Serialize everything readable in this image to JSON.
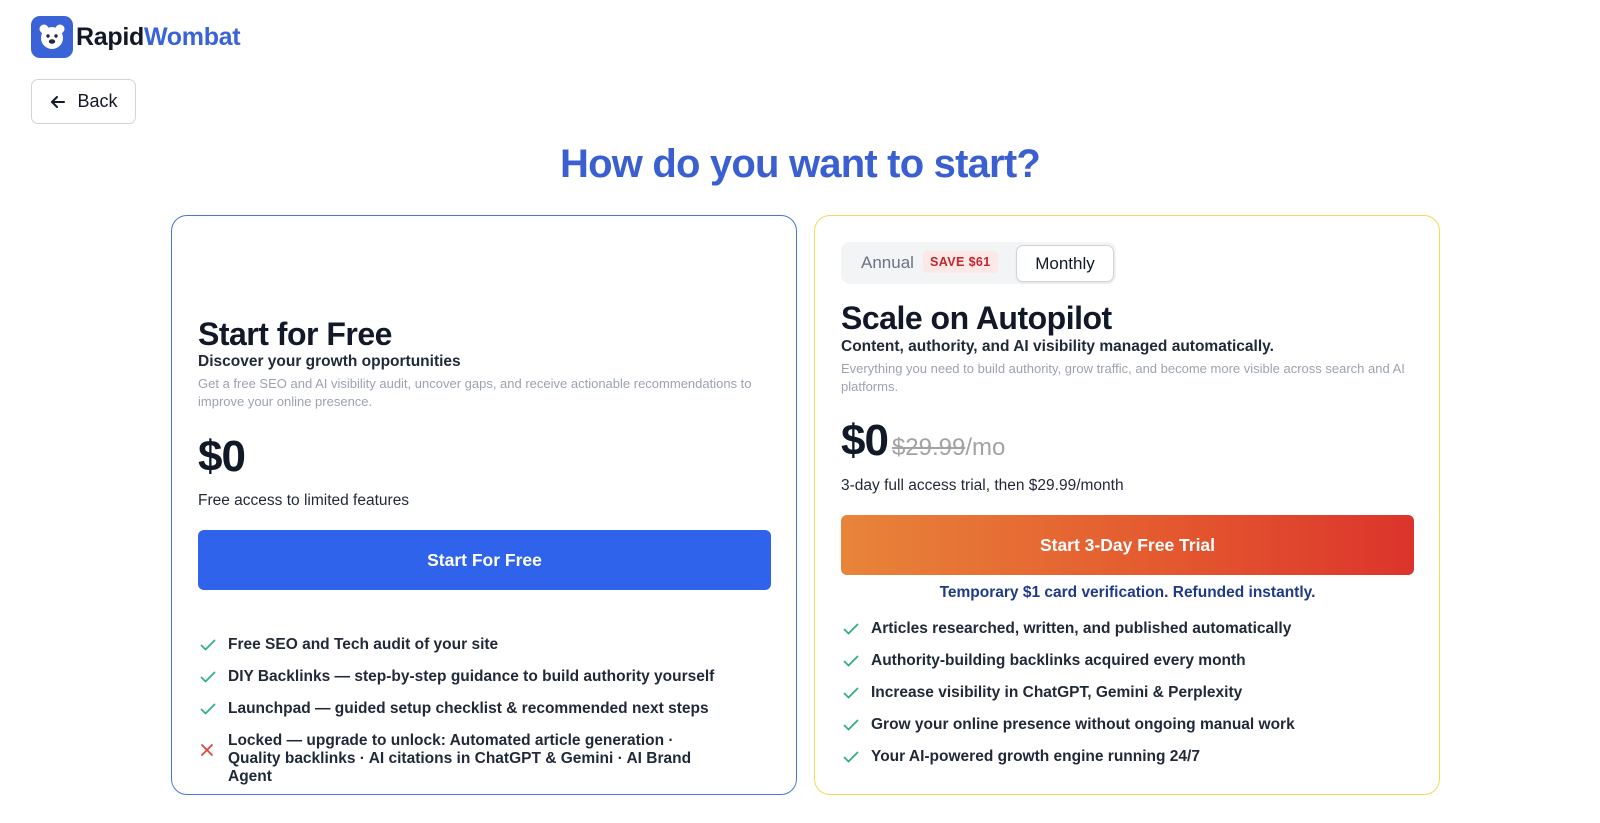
{
  "brand": {
    "name_part1": "Rapid",
    "name_part2": "Wombat",
    "accent_color": "#3a63d8"
  },
  "nav": {
    "back_label": "Back"
  },
  "heading": "How do you want to start?",
  "free_plan": {
    "title": "Start for Free",
    "subtitle": "Discover your growth opportunities",
    "description": "Get a free SEO and AI visibility audit, uncover gaps, and receive actionable recommendations to improve your online presence.",
    "price": "$0",
    "price_note": "Free access to limited features",
    "cta_label": "Start For Free",
    "features": [
      {
        "text": "Free SEO and Tech audit of your site",
        "icon": "check-icon"
      },
      {
        "text": "DIY Backlinks — step-by-step guidance to build authority yourself",
        "icon": "check-icon"
      },
      {
        "text": "Launchpad — guided setup checklist & recommended next steps",
        "icon": "check-icon"
      },
      {
        "text": "Locked — upgrade to unlock: Automated article generation · Quality backlinks · AI citations in ChatGPT & Gemini · AI Brand Agent",
        "icon": "x-icon"
      }
    ]
  },
  "pro_plan": {
    "billing_toggle": {
      "annual_label": "Annual",
      "save_badge": "SAVE $61",
      "monthly_label": "Monthly",
      "selected": "Monthly"
    },
    "title": "Scale on Autopilot",
    "subtitle": "Content, authority, and AI visibility managed automatically.",
    "description": "Everything you need to build authority, grow traffic, and become more visible across search and AI platforms.",
    "price": "$0",
    "original_price": "$29.99",
    "price_period": "/mo",
    "price_note": "3-day full access trial, then $29.99/month",
    "cta_label": "Start 3-Day Free Trial",
    "verification_note": "Temporary $1 card verification. Refunded instantly.",
    "features": [
      {
        "text": "Articles researched, written, and published automatically",
        "icon": "check-icon"
      },
      {
        "text": "Authority-building backlinks acquired every month",
        "icon": "check-icon"
      },
      {
        "text": "Increase visibility in ChatGPT, Gemini & Perplexity",
        "icon": "check-icon"
      },
      {
        "text": "Grow your online presence without ongoing manual work",
        "icon": "check-icon"
      },
      {
        "text": "Your AI-powered growth engine running 24/7",
        "icon": "check-icon"
      }
    ]
  },
  "colors": {
    "heading": "#3a5fd1",
    "free_border": "#4f74d9",
    "pro_border": "#f1dc5a",
    "cta_blue": "#2f63eb",
    "check": "#2fb37a",
    "cross": "#e0443e"
  }
}
